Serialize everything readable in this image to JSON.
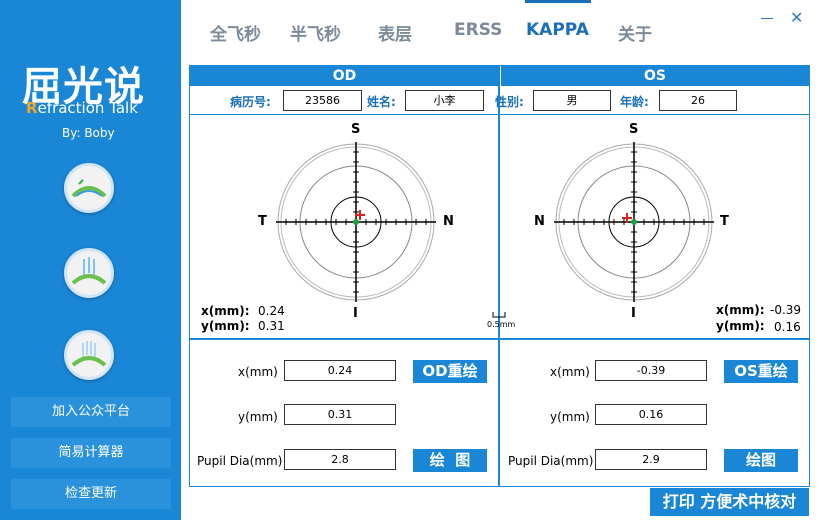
{
  "sidebar": {
    "logo_cn": "屈光说",
    "logo_en_first": "R",
    "logo_en_rest": "efraction Talk",
    "by": "By: Boby",
    "buttons": [
      "加入公众平台",
      "简易计算器",
      "检查更新"
    ]
  },
  "tabs": [
    "全飞秒",
    "半飞秒",
    "表层",
    "ERSS",
    "KAPPA",
    "关于"
  ],
  "active_tab": "KAPPA",
  "window": {
    "close": "✕"
  },
  "patient": {
    "od_header": "OD",
    "os_header": "OS",
    "record_label": "病历号:",
    "record_value": "23586",
    "name_label": "姓名:",
    "name_value": "小李",
    "gender_label": "性别:",
    "gender_value": "男",
    "age_label": "年龄:",
    "age_value": "26"
  },
  "chart": {
    "od_axes": {
      "top": "S",
      "bottom": "I",
      "left": "T",
      "right": "N"
    },
    "os_axes": {
      "top": "S",
      "bottom": "I",
      "left": "N",
      "right": "T"
    },
    "x_label": "x(mm):",
    "y_label": "y(mm):",
    "od_x": "0.24",
    "od_y": "0.31",
    "os_x": "-0.39",
    "os_y": "0.16",
    "scale": "0.5mm"
  },
  "form": {
    "x_label": "x(mm)",
    "y_label": "y(mm)",
    "pupil_label": "Pupil Dia(mm)",
    "od": {
      "x": "0.24",
      "y": "0.31",
      "pupil": "2.8",
      "redraw": "OD重绘",
      "draw": "绘  图"
    },
    "os": {
      "x": "-0.39",
      "y": "0.16",
      "pupil": "2.9",
      "redraw": "OS重绘",
      "draw": "绘图"
    }
  },
  "print_button": "打印 方便术中核对",
  "colors": {
    "accent": "#1a86d6",
    "marker_red": "#e02020",
    "marker_green": "#1aa33a"
  }
}
